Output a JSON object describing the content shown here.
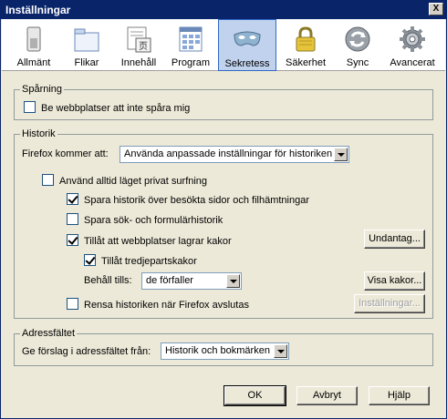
{
  "window": {
    "title": "Inställningar",
    "close_label": "X"
  },
  "tabs": [
    {
      "label": "Allmänt",
      "icon": "switch-icon"
    },
    {
      "label": "Flikar",
      "icon": "tabs-icon"
    },
    {
      "label": "Innehåll",
      "icon": "content-icon"
    },
    {
      "label": "Program",
      "icon": "applications-icon"
    },
    {
      "label": "Sekretess",
      "icon": "mask-icon",
      "selected": true
    },
    {
      "label": "Säkerhet",
      "icon": "padlock-icon"
    },
    {
      "label": "Sync",
      "icon": "sync-icon"
    },
    {
      "label": "Avancerat",
      "icon": "gear-icon"
    }
  ],
  "tracking": {
    "legend": "Spårning",
    "dnt_label": "Be webbplatser att inte spåra mig",
    "dnt_checked": false
  },
  "history": {
    "legend": "Historik",
    "mode_label": "Firefox kommer att:",
    "mode_value": "Använda anpassade inställningar för historiken",
    "private_label": "Använd alltid läget privat surfning",
    "private_checked": false,
    "remember_history_label": "Spara historik över besökta sidor och filhämtningar",
    "remember_history_checked": true,
    "remember_forms_label": "Spara sök- och formulärhistorik",
    "remember_forms_checked": false,
    "accept_cookies_label": "Tillåt att webbplatser lagrar kakor",
    "accept_cookies_checked": true,
    "exceptions_button": "Undantag...",
    "third_party_label": "Tillåt tredjepartskakor",
    "third_party_checked": true,
    "keep_until_label": "Behåll tills:",
    "keep_until_value": "de förfaller",
    "show_cookies_button": "Visa kakor...",
    "clear_on_close_label": "Rensa historiken när Firefox avslutas",
    "clear_on_close_checked": false,
    "settings_button": "Inställningar..."
  },
  "location_bar": {
    "legend": "Adressfältet",
    "suggest_label": "Ge förslag i adressfältet från:",
    "suggest_value": "Historik och bokmärken"
  },
  "footer": {
    "ok": "OK",
    "cancel": "Avbryt",
    "help": "Hjälp"
  }
}
